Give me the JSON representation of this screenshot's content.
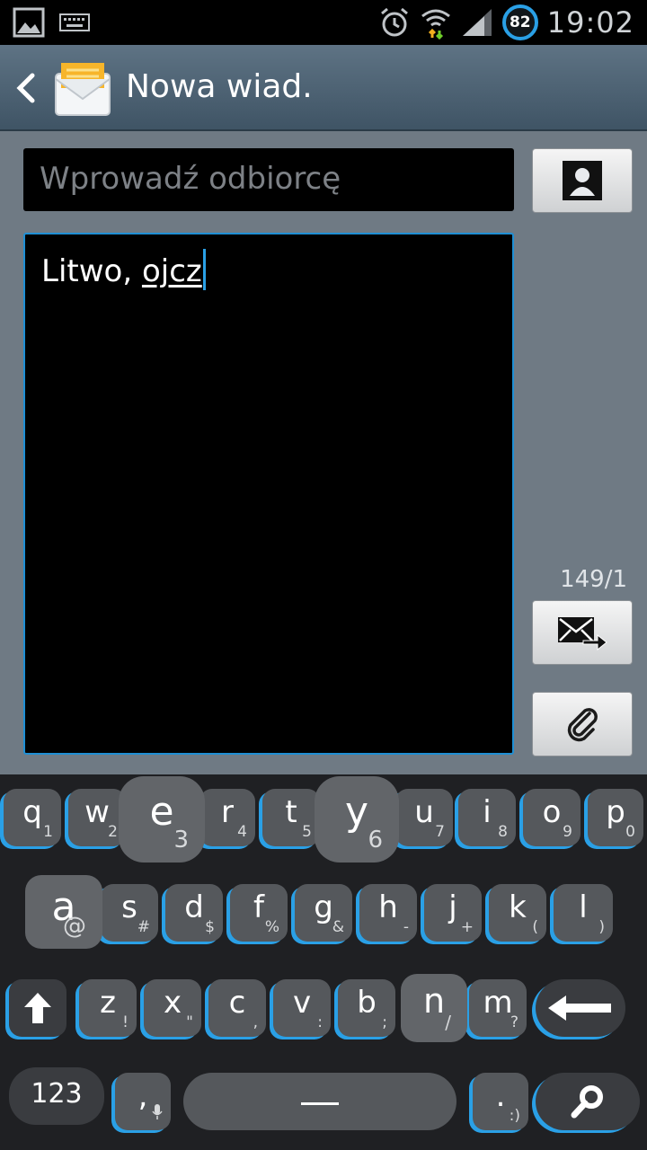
{
  "status": {
    "battery": "82",
    "time": "19:02"
  },
  "header": {
    "title": "Nowa wiad."
  },
  "compose": {
    "recipient_placeholder": "Wprowadź odbiorcę",
    "message_prefix": "Litwo, ",
    "message_current_word": "ojcz",
    "counter": "149/1"
  },
  "keyboard": {
    "row1": [
      {
        "main": "q",
        "sub": "1"
      },
      {
        "main": "w",
        "sub": "2"
      },
      {
        "main": "e",
        "sub": "3"
      },
      {
        "main": "r",
        "sub": "4"
      },
      {
        "main": "t",
        "sub": "5"
      },
      {
        "main": "y",
        "sub": "6"
      },
      {
        "main": "u",
        "sub": "7"
      },
      {
        "main": "i",
        "sub": "8"
      },
      {
        "main": "o",
        "sub": "9"
      },
      {
        "main": "p",
        "sub": "0"
      }
    ],
    "row2": [
      {
        "main": "a",
        "sub": "@"
      },
      {
        "main": "s",
        "sub": "#"
      },
      {
        "main": "d",
        "sub": "$"
      },
      {
        "main": "f",
        "sub": "%"
      },
      {
        "main": "g",
        "sub": "&"
      },
      {
        "main": "h",
        "sub": "-"
      },
      {
        "main": "j",
        "sub": "+"
      },
      {
        "main": "k",
        "sub": "("
      },
      {
        "main": "l",
        "sub": ")"
      }
    ],
    "row3": [
      {
        "main": "z",
        "sub": "!"
      },
      {
        "main": "x",
        "sub": "\""
      },
      {
        "main": "c",
        "sub": ","
      },
      {
        "main": "v",
        "sub": ":"
      },
      {
        "main": "b",
        "sub": ";"
      },
      {
        "main": "n",
        "sub": "/"
      },
      {
        "main": "m",
        "sub": "?"
      }
    ],
    "num_label": "123",
    "comma": {
      "main": ",",
      "sub": ""
    },
    "period": {
      "main": ".",
      "sub": ":)"
    }
  },
  "icons": {
    "back": "chevron-left-icon",
    "app": "envelope-icon",
    "contact": "contact-icon",
    "send": "send-message-icon",
    "attach": "paperclip-icon",
    "shift": "shift-arrow-icon",
    "backspace": "backspace-arrow-icon",
    "search": "search-icon",
    "mic": "microphone-icon",
    "space": "space-bar-icon"
  },
  "colors": {
    "accent": "#2aa0e6",
    "actionbar": "#4f6476",
    "compose_bg": "#6f7a84"
  }
}
